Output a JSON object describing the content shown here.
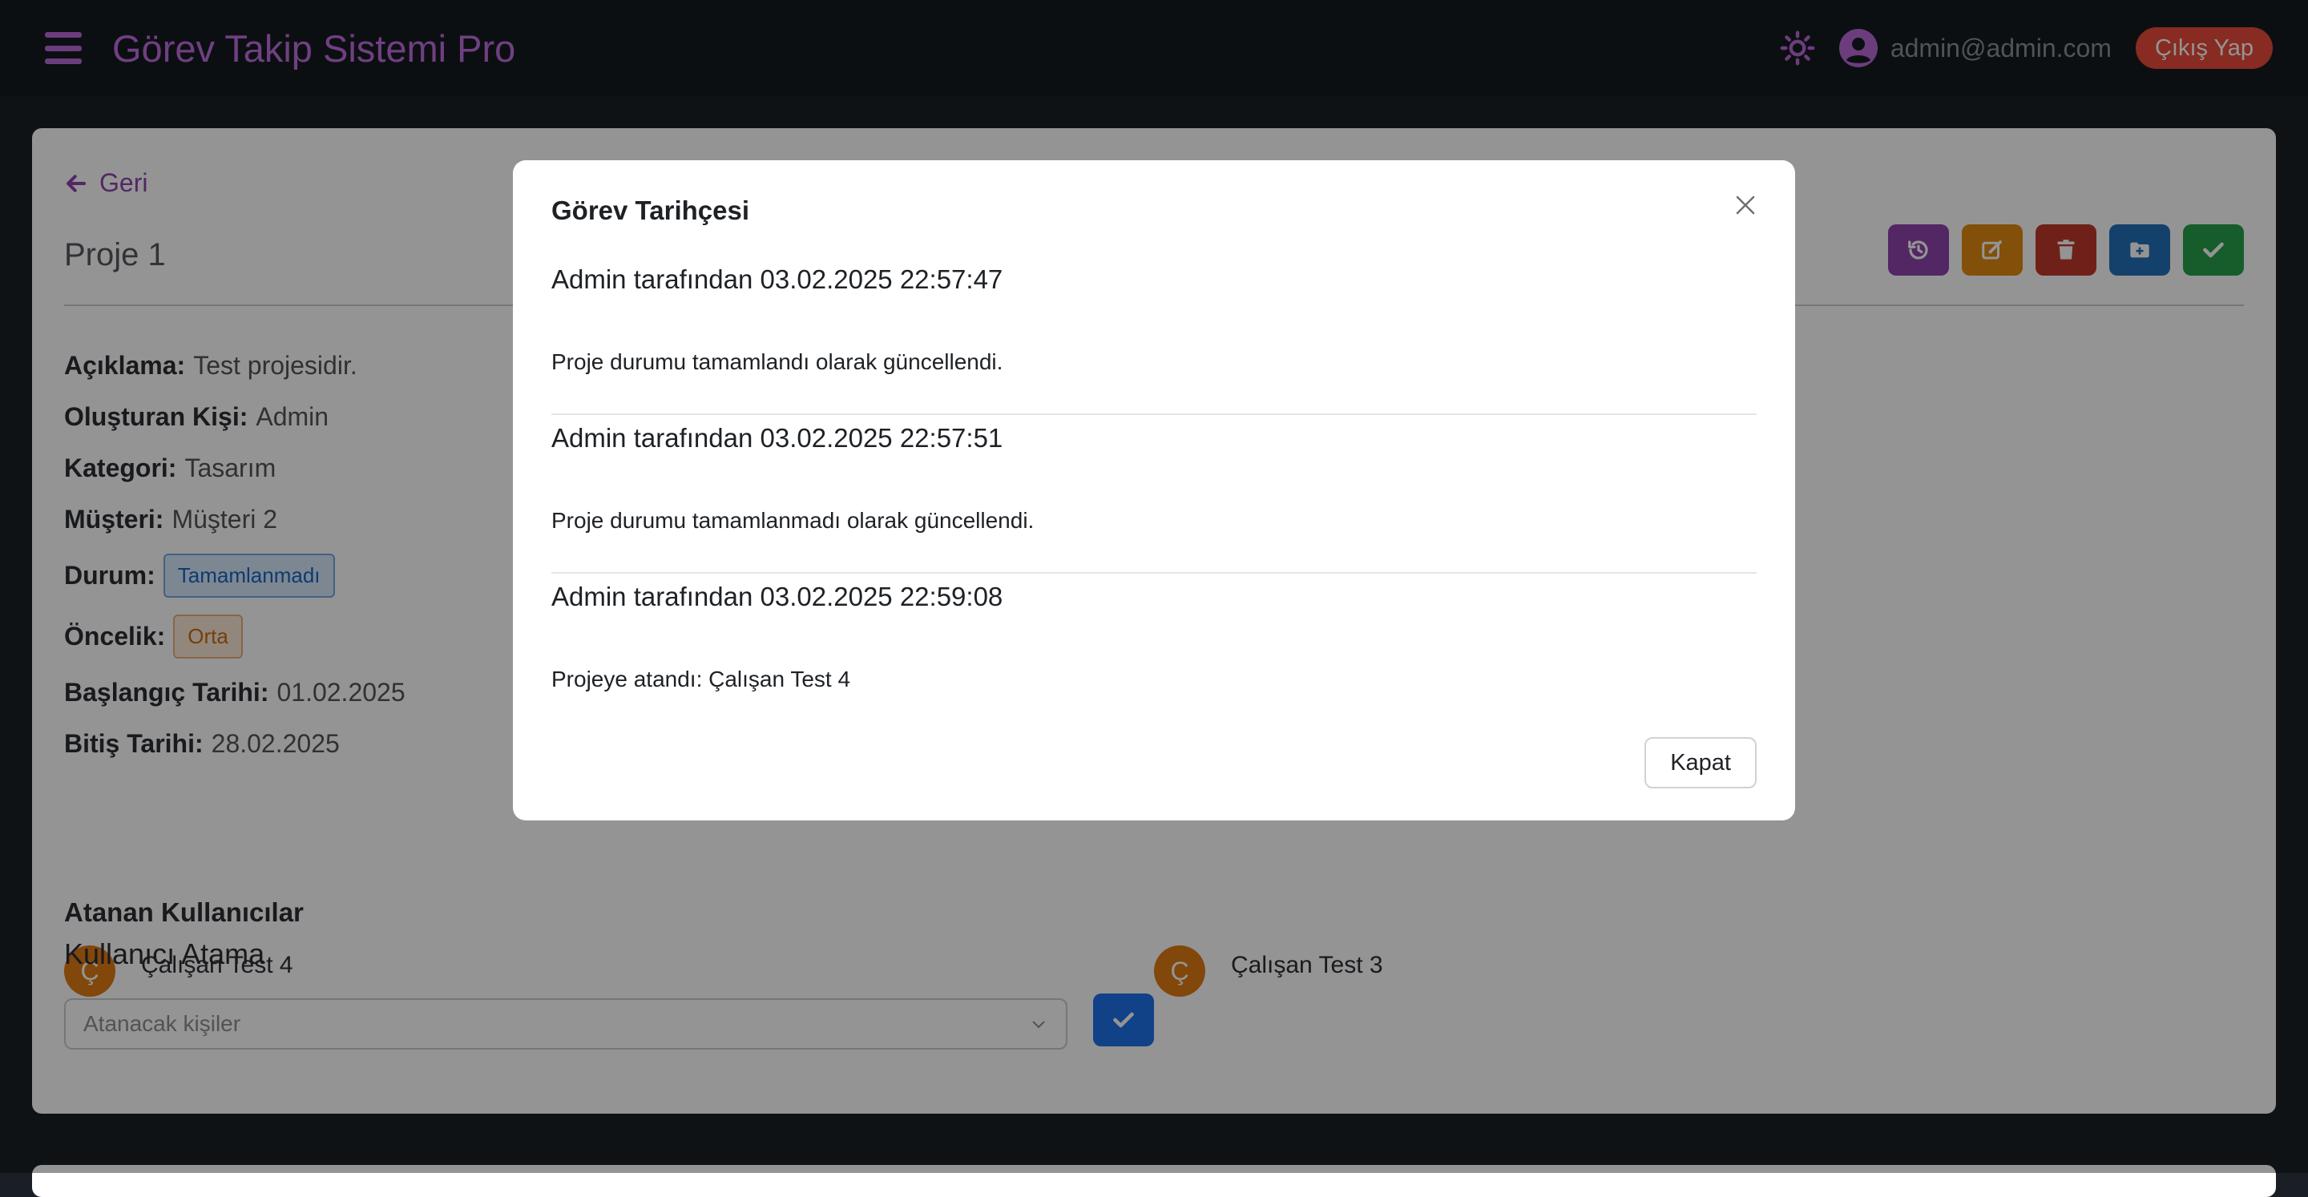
{
  "navbar": {
    "brand": "Görev Takip Sistemi Pro",
    "user_email": "admin@admin.com",
    "logout_label": "Çıkış Yap",
    "accent_color": "#bf6fdf"
  },
  "project": {
    "back_label": "Geri",
    "title": "Proje 1",
    "details": [
      {
        "label": "Açıklama:",
        "value": "Test projesidir."
      },
      {
        "label": "Oluşturan Kişi:",
        "value": "Admin"
      },
      {
        "label": "Kategori:",
        "value": "Tasarım"
      },
      {
        "label": "Müşteri:",
        "value": "Müşteri 2"
      }
    ],
    "status_label": "Durum:",
    "status_value": "Tamamlanmadı",
    "priority_label": "Öncelik:",
    "priority_value": "Orta",
    "start_label": "Başlangıç Tarihi:",
    "start_value": "01.02.2025",
    "end_label": "Bitiş Tarihi:",
    "end_value": "28.02.2025",
    "assigned_title": "Atanan Kullanıcılar",
    "assignees": [
      {
        "initial": "Ç",
        "name": "Çalışan Test 4"
      },
      {
        "initial": "Ç",
        "name": "Çalışan Test 3"
      }
    ],
    "assign_title": "Kullanıcı Atama",
    "assign_placeholder": "Atanacak kişiler",
    "action_buttons": [
      {
        "icon": "history-icon",
        "color": "#8e44ad"
      },
      {
        "icon": "edit-icon",
        "color": "#e08a10"
      },
      {
        "icon": "trash-icon",
        "color": "#c0392b"
      },
      {
        "icon": "folder-plus-icon",
        "color": "#2471b8"
      },
      {
        "icon": "check-icon",
        "color": "#27a04a"
      }
    ]
  },
  "modal": {
    "title": "Görev Tarihçesi",
    "close_label": "Kapat",
    "entries": [
      {
        "header": "Admin tarafından 03.02.2025 22:57:47",
        "text": "Proje durumu tamamlandı olarak güncellendi."
      },
      {
        "header": "Admin tarafından 03.02.2025 22:57:51",
        "text": "Proje durumu tamamlanmadı olarak güncellendi."
      },
      {
        "header": "Admin tarafından 03.02.2025 22:59:08",
        "text": "Projeye atandı: Çalışan Test 4"
      }
    ]
  }
}
